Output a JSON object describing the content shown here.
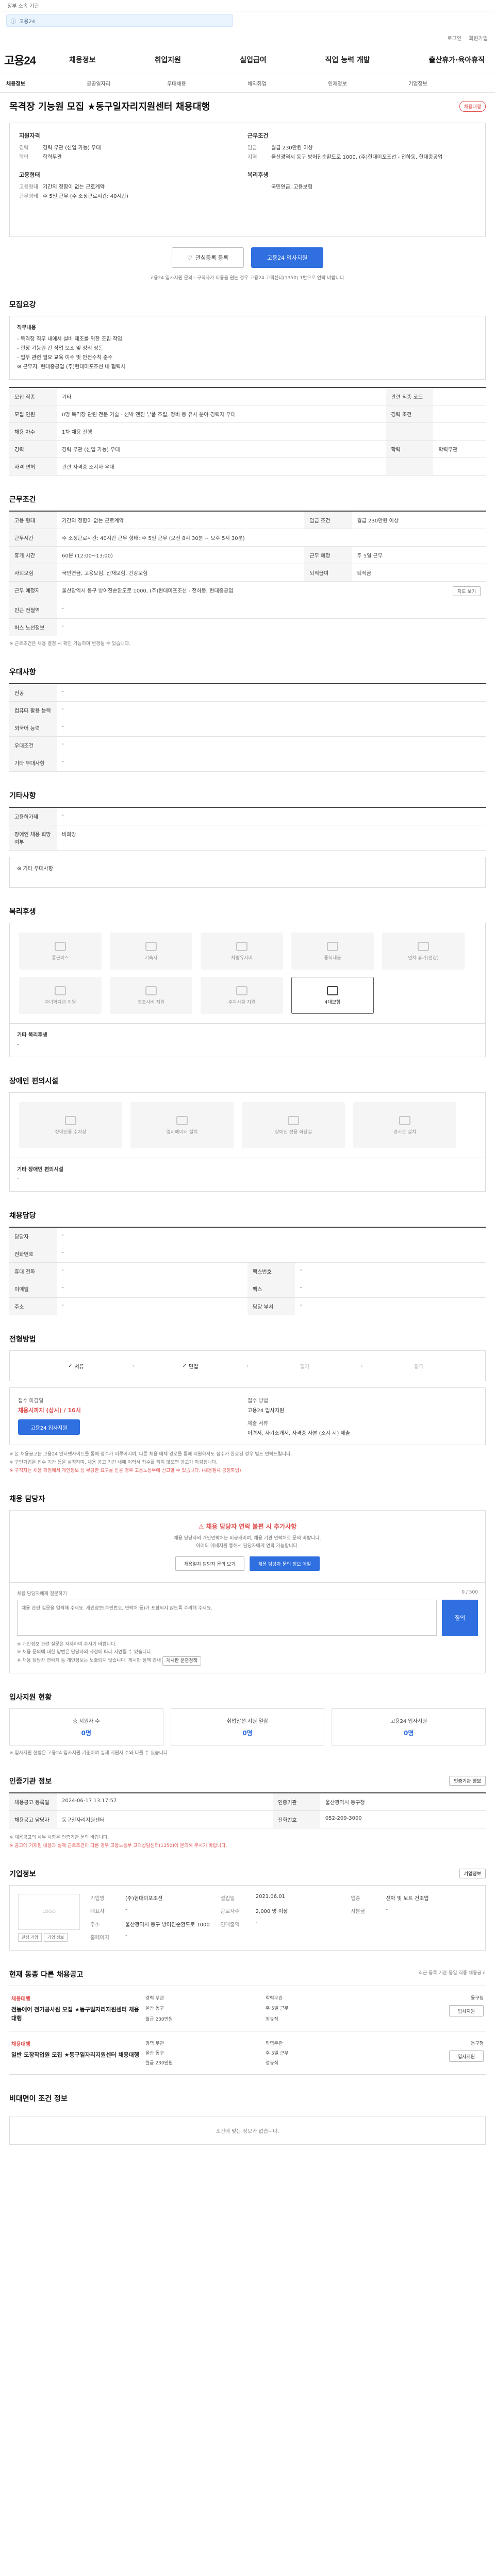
{
  "topbar": {
    "left": "정부 소속 기관",
    "right": ""
  },
  "notice": {
    "text": "고용24"
  },
  "util": {
    "links": [
      "로그인",
      "회원가입"
    ]
  },
  "header": {
    "logo": "고용24",
    "menu": [
      "채용정보",
      "취업지원",
      "실업급여",
      "직업 능력 개발",
      "출산휴가·육아휴직"
    ]
  },
  "subnav": [
    "채용정보",
    "공공일자리",
    "우대채용",
    "해외취업",
    "인재정보",
    "기업정보"
  ],
  "job": {
    "title": "목격장 기능원 모집 ★동구일자리지원센터 채용대행",
    "status_badge": "채용대행",
    "summary": {
      "left_heading": "지원자격",
      "left": [
        {
          "k": "경력",
          "v": "경력 무관 (신입 가능) 우대"
        },
        {
          "k": "학력",
          "v": "학력무관"
        }
      ],
      "left_heading2": "고용형태",
      "left2": [
        {
          "k": "고용형태",
          "v": "기간의 정함이 없는 근로계약"
        },
        {
          "k": "근무형태",
          "v": "주 5일 근무 (주 소정근로시간: 40시간)"
        }
      ],
      "right_heading": "근무조건",
      "right": [
        {
          "k": "임금",
          "v": "월급 230만원 이상"
        },
        {
          "k": "지역",
          "v": "울산광역시 동구 방어진순환도로 1000, (주)현대미포조선 - 전하동, 현대중공업"
        }
      ],
      "right_heading2": "복리후생",
      "right2": [
        {
          "k": "",
          "v": "국민연금, 고용보험"
        }
      ]
    },
    "apply": {
      "save_label": "관심등록 등록",
      "apply_label": "고용24 입사지원",
      "note": "고용24 입사지원 문의 : 구직자가 이용을 원는 경우 고용24 고객센터(1350) 1번으로 연락 바랍니다."
    }
  },
  "sections": {
    "duty": {
      "title": "모집요강",
      "heading": "직무내용",
      "lines": [
        "- 목격장 직무 내에서 설비 제조를 위한 조립 작업",
        "- 현장 기능원 간 작업 보조 및 정리 정돈",
        "- 업무 관련 필요 교육 이수 및 안전수칙 준수",
        "※ 근무지: 현대중공업 (주)현대미포조선 내 협력사"
      ],
      "rows": [
        {
          "k": "모집 직종",
          "v": "기타",
          "k2": "관련 직종 코드",
          "v2": ""
        },
        {
          "k": "모집 인원",
          "v": "0명 목격장 관련 전문 기술 - 선박 엔진 부품 조립, 정비 등 유사 분야 경력자 우대",
          "k2": "경력 조건",
          "v2": ""
        },
        {
          "k": "채용 차수",
          "v": "1차 채용 진행",
          "k2": "",
          "v2": ""
        },
        {
          "k": "경력",
          "v": "경력 무관 (신입 가능) 우대",
          "k2": "학력",
          "v2": "학력무관"
        },
        {
          "k": "자격 면허",
          "v": "관련 자격증 소지자 우대",
          "k2": "",
          "v2": ""
        }
      ]
    },
    "conditions": {
      "title": "근무조건",
      "rows": [
        {
          "k": "고용 형태",
          "v": "기간의 정함이 없는 근로계약",
          "k2": "임금 조건",
          "v2": "월급 230만원 이상"
        },
        {
          "k": "근무시간",
          "v": "주 소정근로시간: 40시간 근무 형태: 주 5일 근무 (오전 8시 30분 ~ 오후 5시 30분)",
          "k2": "",
          "v2": ""
        },
        {
          "k": "휴게 시간",
          "v": "60분 (12:00~13:00)",
          "k2": "근무 예정",
          "v2": "주 5일 근무"
        },
        {
          "k": "사회보험",
          "v": "국민연금, 고용보험, 산재보험, 건강보험",
          "k2": "퇴직급여",
          "v2": "퇴직금"
        },
        {
          "k": "근무 예정지",
          "v": "울산광역시 동구 방어진순환도로 1000, (주)현대미포조선 - 전하동, 현대중공업",
          "k2": "",
          "v2": ""
        },
        {
          "k": "인근 전철역",
          "v": "-",
          "k2": "",
          "v2": ""
        },
        {
          "k": "버스 노선정보",
          "v": "-",
          "k2": "",
          "v2": ""
        }
      ],
      "map_button": "지도 보기",
      "footnote": "※ 근로조건은 채용 결정 시 확인 가능하며 변경될 수 있습니다."
    },
    "preference": {
      "title": "우대사항",
      "rows": [
        {
          "k": "전공",
          "v": "-"
        },
        {
          "k": "컴퓨터 활용 능력",
          "v": "-"
        },
        {
          "k": "외국어 능력",
          "v": "-"
        },
        {
          "k": "우대조건",
          "v": "-"
        },
        {
          "k": "기타 우대사항",
          "v": "-"
        }
      ]
    },
    "etc": {
      "title": "기타사항",
      "rows": [
        {
          "k": "고용허가제",
          "v": "-"
        },
        {
          "k": "장애인 채용 희망 여부",
          "v": "비희망"
        }
      ],
      "extra": "※ 기타 우대사항"
    },
    "welfare": {
      "title": "복리후생",
      "items": [
        "통근버스",
        "기숙사",
        "차량유지비",
        "중식제공",
        "연차 휴가(연장)",
        "자녀학자금 지원",
        "경조사비 지원",
        "주차시설 지원",
        "4대보험"
      ],
      "active": [
        8
      ],
      "other_label": "기타 복리후생",
      "other_value": "-"
    },
    "disability": {
      "title": "장애인 편의시설",
      "items": [
        "장애인용 주차장",
        "엘리베이터 설치",
        "장애인 전용 화장실",
        "경사로 설치"
      ],
      "other_label": "기타 장애인 편의시설",
      "other_value": "-"
    },
    "manager": {
      "title": "채용담당",
      "rows": [
        {
          "k": "담당자",
          "v": "-",
          "k2": "",
          "v2": ""
        },
        {
          "k": "전화번호",
          "v": "-",
          "k2": "",
          "v2": ""
        },
        {
          "k": "휴대 전화",
          "v": "-",
          "k2": "팩스번호",
          "v2": "-"
        },
        {
          "k": "이메일",
          "v": "-",
          "k2": "팩스",
          "v2": "-"
        },
        {
          "k": "주소",
          "v": "-",
          "k2": "담당 부서",
          "v2": "-"
        }
      ]
    },
    "process": {
      "title": "전형방법",
      "steps": [
        "서류",
        "면접",
        "필기",
        "합격"
      ],
      "active": [
        0,
        1
      ],
      "deadline_label": "접수 마감일",
      "deadline": "채용시까지 (상시) / 16시",
      "apply_btn": "고용24 입사지원",
      "method_label": "접수 방법",
      "method": "고용24 입사지원",
      "docs_label": "제출 서류",
      "docs": "이력서, 자기소개서, 자격증 사본 (소지 시) 제출",
      "notes": [
        "※ 본 채용공고는 고용24 인터넷사이트를 통해 접수가 이루어지며, 다른 채용 매체 경로를 통해 지원하셔도 접수가 완료된 경우 별도 연락드립니다.",
        "※ 구인기업은 접수 기간 등을 설정하며, 채용 공고 기간 내에 이력서 접수를 하지 않으면 공고가 마감됩니다.",
        "※ 구직자는 채용 과정에서 개인정보 등 부당한 요구를 받을 경우 고용노동부에 신고할 수 있습니다. (채용절차 공정화법)"
      ]
    },
    "contact": {
      "title": "채용 담당자",
      "alert": "채용 담당자 연락 불편 시 추가사항",
      "sub": "채용 담당자의 개인연락처는 비공개이며, 채용 기관 연락처로 문의 바랍니다.\n아래의 메세지를 통해서 담당자에게 연락 가능합니다.",
      "btn1": "채용절차 담당자 문의 보기",
      "btn2": "채용 담당자 문의 정보 메일"
    },
    "qa": {
      "label": "채용 담당자에게 질문하기",
      "counter": "0 / 500",
      "placeholder": "채용 관련 질문을 입력해 주세요. 개인정보(주민번호, 연락처 등)가 포함되지 않도록 주의해 주세요.",
      "submit": "질의",
      "notes": [
        "※ 개인정보 관련 질문은 자제하여 주시기 바랍니다.",
        "※ 채용 문의에 대한 답변은 담당자의 사정에 따라 지연될 수 있습니다.",
        "※ 채용 담당자 연락처 등 개인정보는 노출되지 않습니다. 게시판 정책 안내"
      ],
      "policy_btn": "게시판 운영정책"
    },
    "status": {
      "title": "입사지원 현황",
      "cards": [
        {
          "label": "총 지원자 수",
          "num": "0명"
        },
        {
          "label": "취업알선 지원 열람",
          "num": "0명"
        },
        {
          "label": "고용24 입사지원",
          "num": "0명"
        }
      ],
      "note": "※ 입사지원 현황은 고용24 입사지원 기준이며 실제 지원자 수와 다를 수 있습니다."
    },
    "info": {
      "title": "인증기관 정보",
      "button": "인증기관 정보",
      "rows": [
        {
          "k": "채용공고 등록일",
          "v": "2024-06-17 13:17:57",
          "k2": "인증기관",
          "v2": "울산광역시 동구청"
        },
        {
          "k": "채용공고 담당자",
          "v": "동구일자리지원센터",
          "k2": "전화번호",
          "v2": "052-209-3000"
        }
      ],
      "notes": [
        "※ 채용공고의 세부 사항은 인증기관 문의 바랍니다.",
        "※ 공고에 기재된 내용과 실제 근로조건이 다른 경우 고용노동부 고객상담센터(1350)에 문의해 주시기 바랍니다."
      ]
    },
    "company": {
      "title": "기업정보",
      "more": "기업정보",
      "logo_text": "LOGO",
      "btn1": "관심 기업",
      "btn2": "기업 정보",
      "rows": [
        {
          "k": "기업명",
          "v": "(주)현대미포조선",
          "k2": "설립일",
          "v2": "2021.06.01",
          "k3": "업종",
          "v3": "선박 및 보트 건조업"
        },
        {
          "k": "대표자",
          "v": "-",
          "k2": "근로자수",
          "v2": "2,000 명 이상",
          "k3": "자본금",
          "v3": "-"
        },
        {
          "k": "주소",
          "v": "울산광역시 동구 방어진순환도로 1000",
          "k2": "연매출액",
          "v2": "-",
          "k3": "",
          "v3": ""
        },
        {
          "k": "홈페이지",
          "v": "-",
          "k2": "",
          "v2": "",
          "k3": "",
          "v3": ""
        }
      ]
    },
    "similar": {
      "title": "현재 동종 다른 채용공고",
      "note": "최근 등록 기준 동일 직종 채용공고",
      "items": [
        {
          "tag": "채용대행",
          "title": "전동에어 전기공사원 모집 ★동구일자리지원센터 채용대행",
          "meta": [
            "경력 무관",
            "학력무관",
            "울산 동구",
            "주 5일 근무",
            "월급 230만원",
            "정규직"
          ],
          "company": "동구청",
          "btn": "입사지원"
        },
        {
          "tag": "채용대행",
          "title": "일반 도장작업원 모집 ★동구일자리지원센터 채용대행",
          "meta": [
            "경력 무관",
            "학력무관",
            "울산 동구",
            "주 5일 근무",
            "월급 230만원",
            "정규직"
          ],
          "company": "동구청",
          "btn": "입사지원"
        }
      ]
    },
    "recommend": {
      "title": "비대면이 조건 정보",
      "text": "조건에 맞는 정보가 없습니다."
    }
  }
}
